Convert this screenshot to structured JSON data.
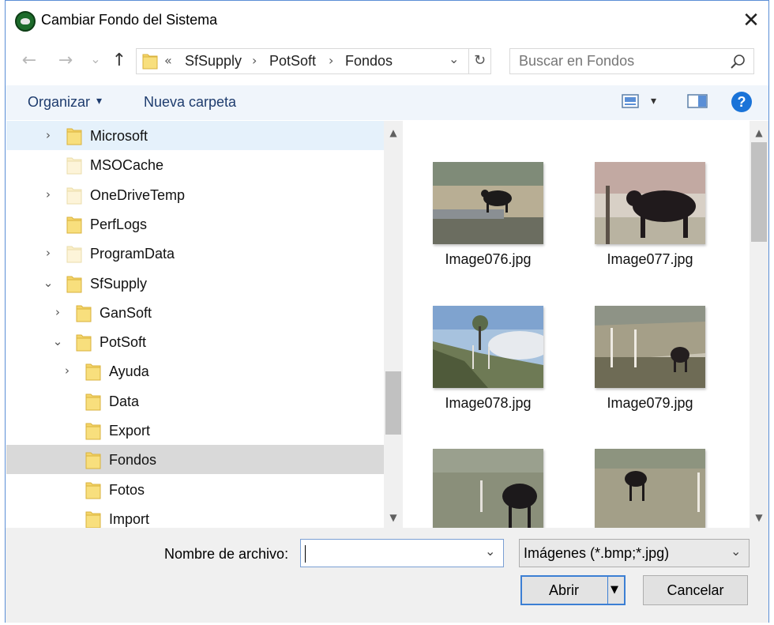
{
  "window": {
    "title": "Cambiar Fondo del Sistema",
    "close_glyph": "✕"
  },
  "nav": {
    "back_glyph": "←",
    "forward_glyph": "→",
    "recent_glyph": "⌄",
    "up_glyph": "↑",
    "breadcrumb_overflow": "«",
    "breadcrumb": [
      "SfSupply",
      "PotSoft",
      "Fondos"
    ],
    "separator": "›",
    "dropdown_glyph": "⌄",
    "refresh_glyph": "↻",
    "search_placeholder": "Buscar en Fondos",
    "search_icon": "search-icon"
  },
  "toolbar": {
    "organize_label": "Organizar",
    "organize_caret": "▾",
    "new_folder_label": "Nueva carpeta",
    "view_caret": "▾",
    "help_glyph": "?"
  },
  "tree": {
    "items": [
      {
        "label": "Microsoft",
        "chevron": "›",
        "state": "hover",
        "faded": false
      },
      {
        "label": "MSOCache",
        "chevron": "",
        "state": "",
        "faded": true
      },
      {
        "label": "OneDriveTemp",
        "chevron": "›",
        "state": "",
        "faded": true
      },
      {
        "label": "PerfLogs",
        "chevron": "",
        "state": "",
        "faded": false
      },
      {
        "label": "ProgramData",
        "chevron": "›",
        "state": "",
        "faded": true
      },
      {
        "label": "SfSupply",
        "chevron": "⌄",
        "state": "",
        "faded": false
      },
      {
        "label": "GanSoft",
        "chevron": "›",
        "state": "",
        "faded": false
      },
      {
        "label": "PotSoft",
        "chevron": "⌄",
        "state": "",
        "faded": false
      },
      {
        "label": "Ayuda",
        "chevron": "›",
        "state": "",
        "faded": false
      },
      {
        "label": "Data",
        "chevron": "",
        "state": "",
        "faded": false
      },
      {
        "label": "Export",
        "chevron": "",
        "state": "",
        "faded": false
      },
      {
        "label": "Fondos",
        "chevron": "",
        "state": "selected",
        "faded": false
      },
      {
        "label": "Fotos",
        "chevron": "",
        "state": "",
        "faded": false
      },
      {
        "label": "Import",
        "chevron": "",
        "state": "",
        "faded": false
      }
    ]
  },
  "files": {
    "items": [
      {
        "name": "Image076.jpg"
      },
      {
        "name": "Image077.jpg"
      },
      {
        "name": "Image078.jpg"
      },
      {
        "name": "Image079.jpg"
      },
      {
        "name": ""
      },
      {
        "name": ""
      }
    ]
  },
  "scroll_glyphs": {
    "up": "▲",
    "down": "▼"
  },
  "footer": {
    "filename_label": "Nombre de archivo:",
    "filename_value": "",
    "filename_dropdown_glyph": "⌄",
    "filter_value": "Imágenes (*.bmp;*.jpg)",
    "filter_dropdown_glyph": "⌄",
    "open_label": "Abrir",
    "open_split_glyph": "▼",
    "cancel_label": "Cancelar"
  },
  "colors": {
    "accent": "#1a73d8",
    "folder": "#f5d56a",
    "selection": "#d9d9d9",
    "hover": "#e5f1fb"
  }
}
